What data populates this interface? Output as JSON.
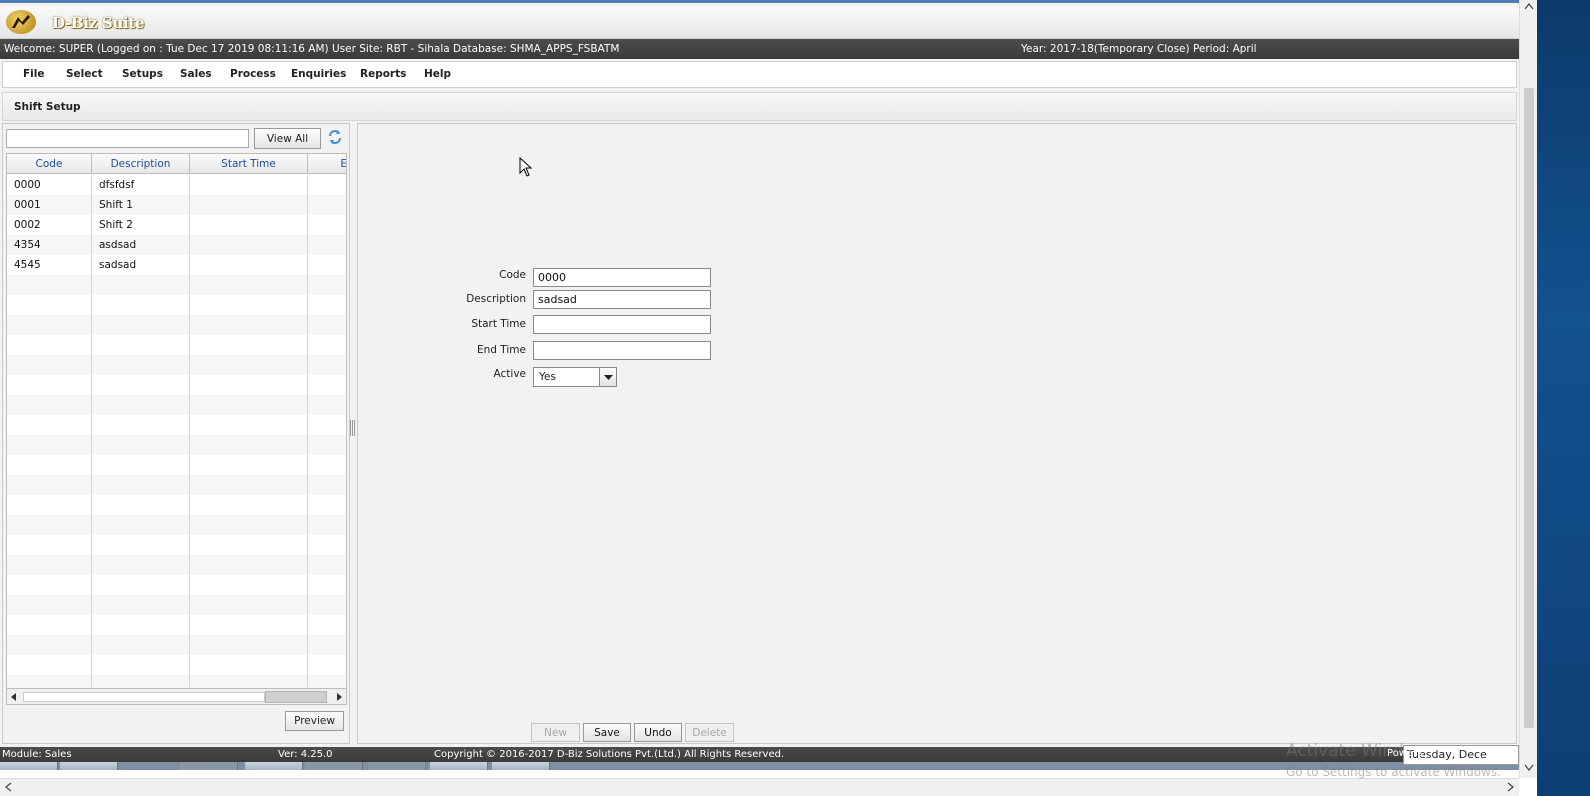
{
  "app": {
    "name": "D-Biz Suite"
  },
  "info_bar": {
    "welcome": "Welcome: SUPER (Logged on : Tue Dec 17 2019 08:11:16 AM) User Site: RBT - Sihala Database: SHMA_APPS_FSBATM",
    "year": "Year: 2017-18(Temporary Close) Period: April"
  },
  "menu": [
    "File",
    "Select",
    "Setups",
    "Sales",
    "Process",
    "Enquiries",
    "Reports",
    "Help"
  ],
  "page": {
    "title": "Shift Setup"
  },
  "search": {
    "value": "",
    "view_all_label": "View All"
  },
  "grid": {
    "columns": [
      "Code",
      "Description",
      "Start Time",
      "E"
    ],
    "rows": [
      [
        "0000",
        "dfsfdsf",
        "",
        ""
      ],
      [
        "0001",
        "Shift 1",
        "",
        ""
      ],
      [
        "0002",
        "Shift 2",
        "",
        ""
      ],
      [
        "4354",
        "asdsad",
        "",
        ""
      ],
      [
        "4545",
        "sadsad",
        "",
        ""
      ]
    ]
  },
  "preview_label": "Preview",
  "form": {
    "code_label": "Code",
    "code_value": "0000",
    "description_label": "Description",
    "description_value": "sadsad",
    "start_time_label": "Start Time",
    "start_time_value": "",
    "end_time_label": "End Time",
    "end_time_value": "",
    "active_label": "Active",
    "active_value": "Yes"
  },
  "actions": {
    "new": "New",
    "save": "Save",
    "undo": "Undo",
    "delete": "Delete"
  },
  "status_bar": {
    "module": "Module: Sales",
    "version": "Ver: 4.25.0",
    "copyright": "Copyright © 2016-2017 D-Biz Solutions Pvt.(Ltd.) All Rights Reserved."
  },
  "overlay": {
    "activate_title": "Activate Windows",
    "activate_sub": "Go to Settings to activate Windows.",
    "clock_prefix": "Powers",
    "clock_tooltip": "Tuesday, Dece"
  },
  "colors": {
    "accent_header_text": "#1c4e9a",
    "info_bar_bg": "#444444",
    "app_bg": "#f2f2f2"
  }
}
